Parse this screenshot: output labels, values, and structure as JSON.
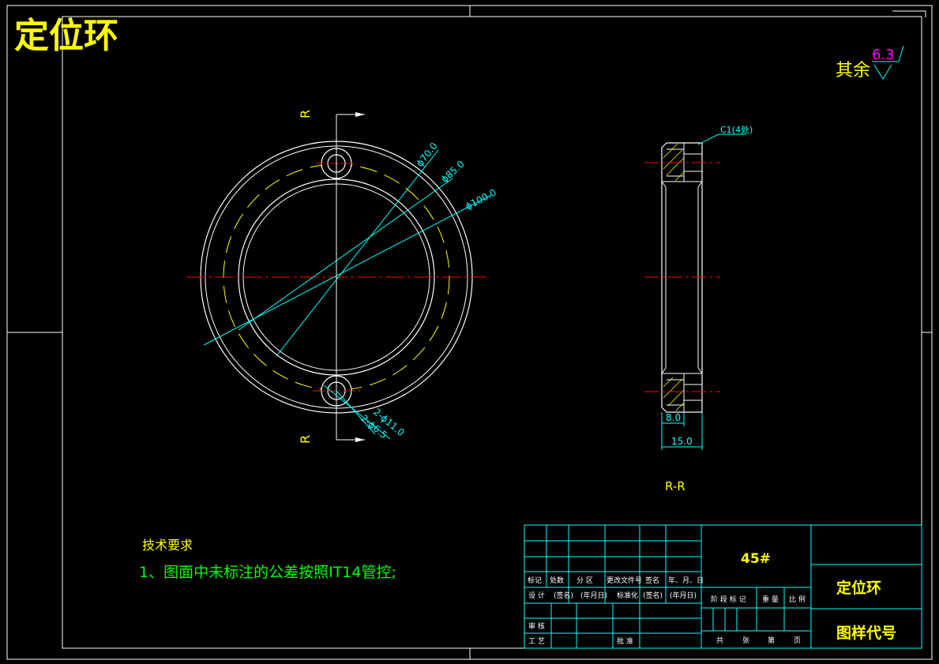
{
  "title": "定位环",
  "roughness": {
    "prefix": "其余",
    "value": "6.3"
  },
  "section_marks": {
    "top": "R",
    "bottom": "R"
  },
  "dimensions": {
    "d70": "ϕ70.0",
    "d85": "ϕ85.0",
    "d100": "ϕ100.0",
    "holes_a": "2-ϕ11.0",
    "holes_b": "2-ϕ6.5",
    "chamfer": "C1(4处)",
    "width_8": "8.0",
    "width_15": "15.0"
  },
  "section_label": "R-R",
  "tech_requirements": {
    "heading": "技术要求",
    "item1": "1、图面中未标注的公差按照IT14管控;"
  },
  "title_block": {
    "material": "45#",
    "part_name": "定位环",
    "drawing_code": "图样代号",
    "rev_headers": [
      "标记",
      "处数",
      "分 区",
      "更改文件号",
      "签名",
      "年、月、日"
    ],
    "row_design": [
      "设 计",
      "(签名)",
      "(年月日)",
      "标准化",
      "(签名)",
      "(年月日)"
    ],
    "row_review": "审 核",
    "row_process": "工 艺",
    "row_approve": "批 准",
    "stage_headers": [
      "阶 段 标 记",
      "重 量",
      "比 例"
    ],
    "sheet_info": [
      "共",
      "张",
      "第",
      "页"
    ]
  }
}
